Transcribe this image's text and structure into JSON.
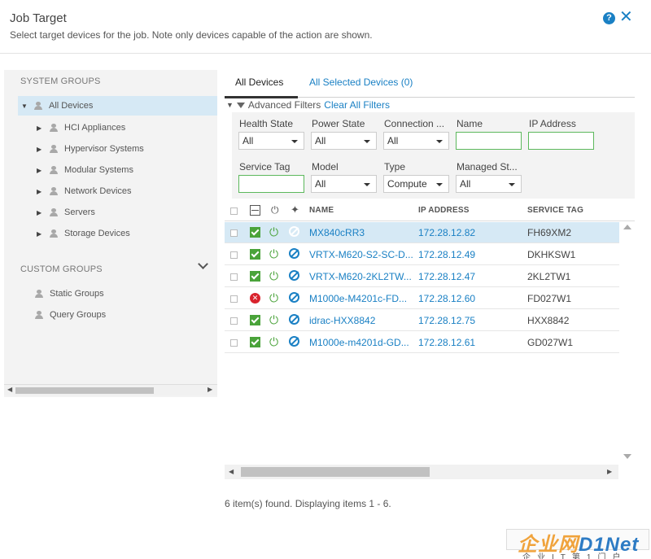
{
  "header": {
    "title": "Job Target",
    "subtitle": "Select target devices for the job. Note only devices capable of the action are shown.",
    "help_glyph": "?",
    "close_glyph": "✕"
  },
  "sidebar": {
    "system_groups_label": "SYSTEM GROUPS",
    "all_devices": "All Devices",
    "system_items": [
      {
        "label": "HCI Appliances"
      },
      {
        "label": "Hypervisor Systems"
      },
      {
        "label": "Modular Systems"
      },
      {
        "label": "Network Devices"
      },
      {
        "label": "Servers"
      },
      {
        "label": "Storage Devices"
      }
    ],
    "custom_groups_label": "CUSTOM GROUPS",
    "custom_items": [
      {
        "label": "Static Groups"
      },
      {
        "label": "Query Groups"
      }
    ]
  },
  "tabs": [
    {
      "label": "All Devices",
      "active": true
    },
    {
      "label": "All Selected Devices (0)",
      "active": false
    }
  ],
  "filters": {
    "advanced_label": "Advanced Filters",
    "clear_label": "Clear All Filters",
    "health_state": {
      "label": "Health State",
      "value": "All"
    },
    "power_state": {
      "label": "Power State",
      "value": "All"
    },
    "connection": {
      "label": "Connection ...",
      "value": "All"
    },
    "name": {
      "label": "Name",
      "value": ""
    },
    "ip_address": {
      "label": "IP Address",
      "value": ""
    },
    "service_tag": {
      "label": "Service Tag",
      "value": ""
    },
    "model": {
      "label": "Model",
      "value": "All"
    },
    "type": {
      "label": "Type",
      "value": "Compute"
    },
    "managed_state": {
      "label": "Managed St...",
      "value": "All"
    }
  },
  "table": {
    "columns": {
      "name": "NAME",
      "ip": "IP ADDRESS",
      "tag": "SERVICE TAG"
    },
    "rows": [
      {
        "health": "ok",
        "name": "MX840cRR3",
        "ip": "172.28.12.82",
        "tag": "FH69XM2",
        "selected": true
      },
      {
        "health": "ok",
        "name": "VRTX-M620-S2-SC-D...",
        "ip": "172.28.12.49",
        "tag": "DKHKSW1",
        "selected": false
      },
      {
        "health": "ok",
        "name": "VRTX-M620-2KL2TW...",
        "ip": "172.28.12.47",
        "tag": "2KL2TW1",
        "selected": false
      },
      {
        "health": "critical",
        "name": "M1000e-M4201c-FD...",
        "ip": "172.28.12.60",
        "tag": "FD027W1",
        "selected": false
      },
      {
        "health": "ok",
        "name": "idrac-HXX8842",
        "ip": "172.28.12.75",
        "tag": "HXX8842",
        "selected": false
      },
      {
        "health": "ok",
        "name": "M1000e-m4201d-GD...",
        "ip": "172.28.12.61",
        "tag": "GD027W1",
        "selected": false
      }
    ]
  },
  "footer": {
    "count_text": "6 item(s) found. Displaying items 1 - 6."
  },
  "watermark": {
    "main_a": "企业网",
    "main_b": "D1Net",
    "sub": "企业IT第1门户"
  },
  "colors": {
    "accent": "#1a80c4",
    "ok": "#4aa33a",
    "critical": "#d9232d",
    "selected_row": "#d6e9f5"
  },
  "icons": {
    "health_column": "health-icon",
    "power_column": "power-plug-icon",
    "connection_column": "connection-icon"
  }
}
